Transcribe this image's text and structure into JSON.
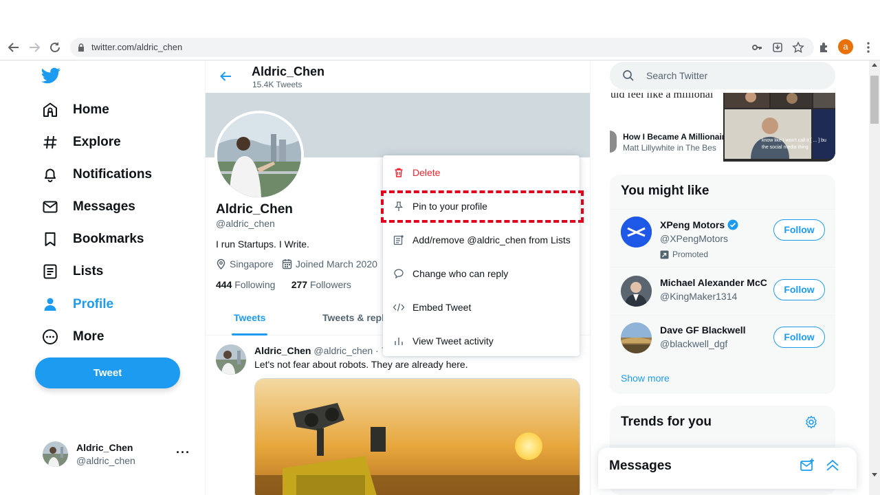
{
  "browser": {
    "url": "twitter.com/aldric_chen",
    "profile_initial": "a"
  },
  "sidebar": {
    "items": [
      {
        "label": "Home",
        "icon": "home-icon"
      },
      {
        "label": "Explore",
        "icon": "hashtag-icon"
      },
      {
        "label": "Notifications",
        "icon": "bell-icon"
      },
      {
        "label": "Messages",
        "icon": "envelope-icon"
      },
      {
        "label": "Bookmarks",
        "icon": "bookmark-icon"
      },
      {
        "label": "Lists",
        "icon": "list-icon"
      },
      {
        "label": "Profile",
        "icon": "person-icon",
        "active": true
      },
      {
        "label": "More",
        "icon": "more-circle-icon"
      }
    ],
    "tweet_label": "Tweet",
    "account": {
      "name": "Aldric_Chen",
      "handle": "@aldric_chen",
      "more": "···"
    }
  },
  "header": {
    "name": "Aldric_Chen",
    "tweet_count": "15.4K Tweets"
  },
  "profile": {
    "name": "Aldric_Chen",
    "handle": "@aldric_chen",
    "bio": "I run Startups. I Write.",
    "location": "Singapore",
    "joined": "Joined March 2020",
    "following_count": "444",
    "following_label": "Following",
    "followers_count": "277",
    "followers_label": "Followers"
  },
  "tabs": [
    {
      "label": "Tweets",
      "active": true
    },
    {
      "label": "Tweets & repl"
    }
  ],
  "tweet": {
    "author": "Aldric_Chen",
    "meta": "@aldric_chen · 7r",
    "text": "Let's not fear about robots. They are already here."
  },
  "context_menu": {
    "items": [
      {
        "label": "Delete",
        "icon": "trash-icon",
        "danger": true
      },
      {
        "label": "Pin to your profile",
        "icon": "pin-icon"
      },
      {
        "label": "Add/remove @aldric_chen from Lists",
        "icon": "list-add-icon"
      },
      {
        "label": "Change who can reply",
        "icon": "speech-bubble-icon"
      },
      {
        "label": "Embed Tweet",
        "icon": "code-icon"
      },
      {
        "label": "View Tweet activity",
        "icon": "bar-chart-icon"
      }
    ]
  },
  "search": {
    "placeholder": "Search Twitter"
  },
  "media_card": {
    "quote": "uld feel like a millionai",
    "title": "How I Became A Millionair",
    "subtitle": "Matt Lillywhite in The Bes",
    "video_caption_1": "know like I won't call it [ ... ] bu",
    "video_caption_2": "the social media thing"
  },
  "who_to_follow": {
    "title": "You might like",
    "accounts": [
      {
        "name": "XPeng Motors",
        "handle": "@XPengMotors",
        "verified": true,
        "promoted": "Promoted",
        "follow": "Follow"
      },
      {
        "name": "Michael Alexander McC",
        "handle": "@KingMaker1314",
        "follow": "Follow"
      },
      {
        "name": "Dave GF Blackwell",
        "handle": "@blackwell_dgf",
        "follow": "Follow"
      }
    ],
    "show_more": "Show more"
  },
  "trends": {
    "title": "Trends for you"
  },
  "messages_drawer": {
    "title": "Messages"
  },
  "colors": {
    "accent": "#1d9bf0",
    "danger": "#f4212e",
    "highlight": "#e0001b"
  }
}
